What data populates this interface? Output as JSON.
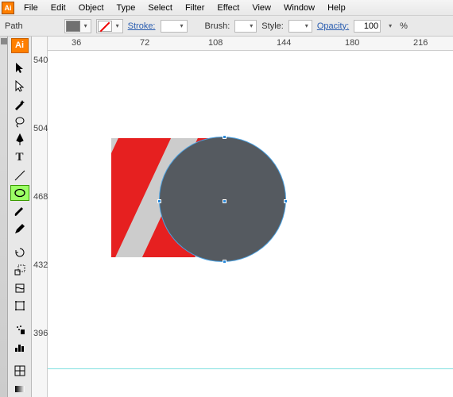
{
  "menu": {
    "file": "File",
    "edit": "Edit",
    "object": "Object",
    "type": "Type",
    "select": "Select",
    "filter": "Filter",
    "effect": "Effect",
    "view": "View",
    "window": "Window",
    "help": "Help"
  },
  "control": {
    "selection": "Path",
    "stroke_label": "Stroke:",
    "brush_label": "Brush:",
    "style_label": "Style:",
    "opacity_label": "Opacity:",
    "opacity_value": "100",
    "opacity_unit": "%"
  },
  "app_badge": "Ai",
  "ruler_h": [
    "36",
    "72",
    "108",
    "144",
    "180",
    "216"
  ],
  "ruler_v": [
    "540",
    "504",
    "468",
    "432",
    "396"
  ],
  "colors": {
    "red": "#e62020",
    "gray": "#cccccc",
    "circle": "#555a60"
  }
}
